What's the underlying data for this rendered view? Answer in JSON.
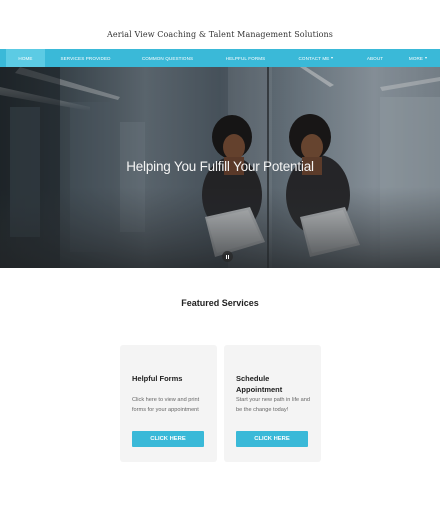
{
  "site": {
    "title": "Aerial View Coaching & Talent Management Solutions"
  },
  "nav": {
    "items": [
      {
        "label": "HOME"
      },
      {
        "label": "SERVICES PROVIDED"
      },
      {
        "label": "COMMON QUESTIONS"
      },
      {
        "label": "HELPFUL FORMS"
      },
      {
        "label": "CONTACT ME"
      },
      {
        "label": "ABOUT"
      },
      {
        "label": "MORE"
      }
    ],
    "active_index": 0
  },
  "hero": {
    "caption": "Helping You Fulfill Your Potential",
    "pause_icon": "pause-icon"
  },
  "featured": {
    "heading": "Featured Services",
    "cards": [
      {
        "title": "Helpful Forms",
        "text": "Click here to view and print forms for your appointment",
        "button": "CLICK HERE"
      },
      {
        "title": "Schedule Appointment",
        "text": "Start your new path in life and be the change today!",
        "button": "CLICK HERE"
      }
    ]
  },
  "colors": {
    "accent": "#3ab9d8",
    "nav_active": "#5ccbe4",
    "card_bg": "#f4f4f4"
  }
}
